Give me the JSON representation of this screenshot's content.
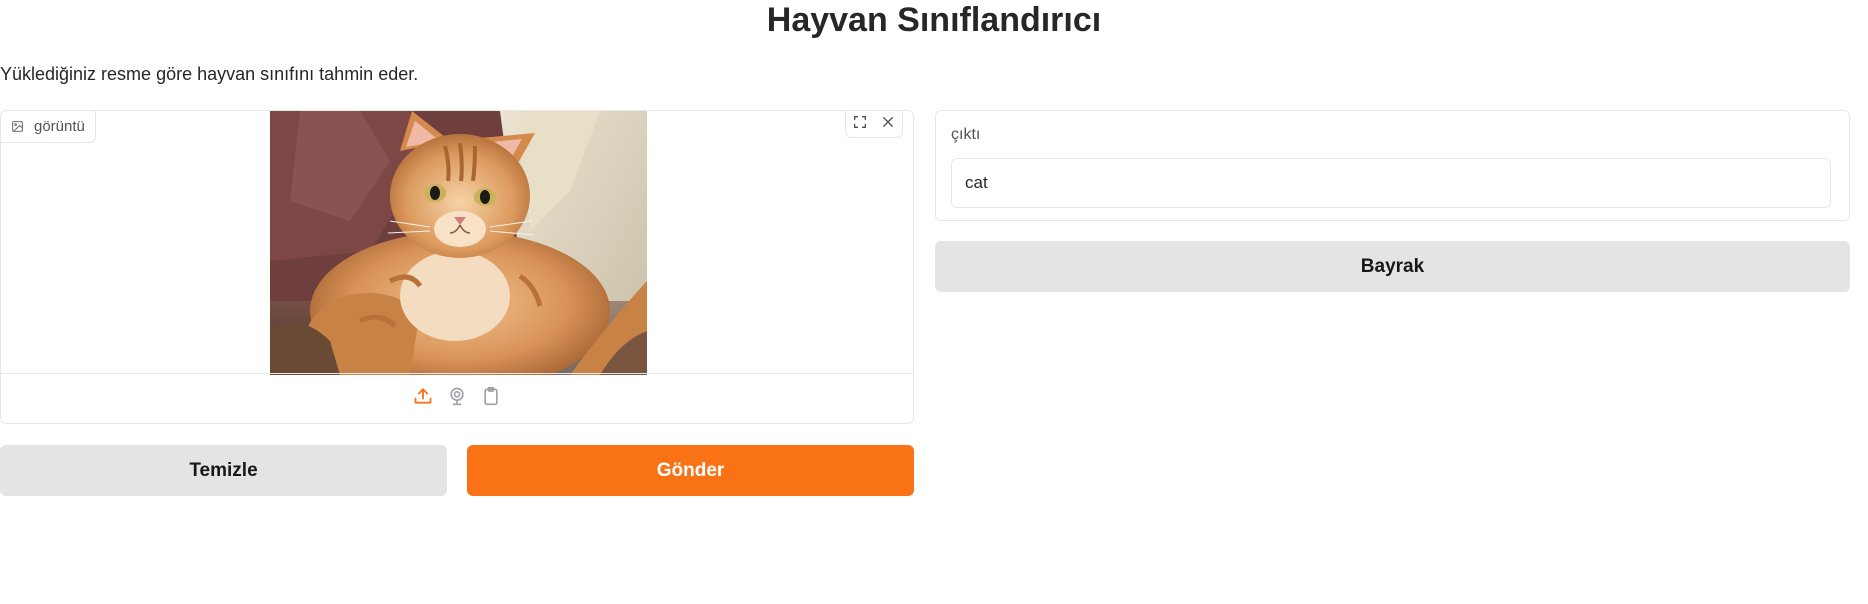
{
  "header": {
    "title": "Hayvan Sınıflandırıcı",
    "description": "Yüklediğiniz resme göre hayvan sınıfını tahmin eder."
  },
  "image_input": {
    "label": "görüntü",
    "label_icon": "image-icon",
    "tools": [
      "fullscreen-icon",
      "close-icon"
    ],
    "sources": [
      "upload-icon",
      "webcam-icon",
      "clipboard-icon"
    ],
    "active_source": "upload-icon",
    "image_subject": "orange tabby cat"
  },
  "buttons": {
    "clear_label": "Temizle",
    "submit_label": "Gönder",
    "flag_label": "Bayrak"
  },
  "output": {
    "label": "çıktı",
    "value": "cat"
  },
  "colors": {
    "accent": "#f97316",
    "secondary_button": "#e4e4e7",
    "border": "#e5e7eb",
    "text": "#27272a"
  }
}
